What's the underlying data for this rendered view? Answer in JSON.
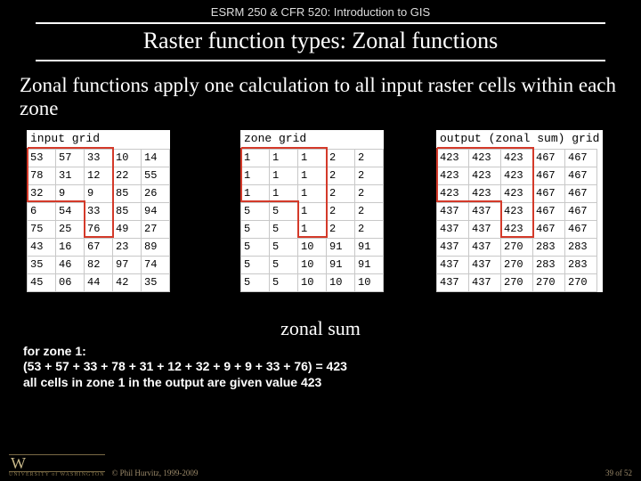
{
  "course_header": "ESRM 250 & CFR 520: Introduction to GIS",
  "slide_title": "Raster function types: Zonal functions",
  "body_text": "Zonal functions apply one calculation to all input raster cells within each zone",
  "grids": {
    "input": {
      "caption": "input grid",
      "rows": [
        [
          "53",
          "57",
          "33",
          "10",
          "14"
        ],
        [
          "78",
          "31",
          "12",
          "22",
          "55"
        ],
        [
          "32",
          "9",
          "9",
          "85",
          "26"
        ],
        [
          "6",
          "54",
          "33",
          "85",
          "94"
        ],
        [
          "75",
          "25",
          "76",
          "49",
          "27"
        ],
        [
          "43",
          "16",
          "67",
          "23",
          "89"
        ],
        [
          "35",
          "46",
          "82",
          "97",
          "74"
        ],
        [
          "45",
          "06",
          "44",
          "42",
          "35"
        ]
      ]
    },
    "zone": {
      "caption": "zone grid",
      "rows": [
        [
          "1",
          "1",
          "1",
          "2",
          "2"
        ],
        [
          "1",
          "1",
          "1",
          "2",
          "2"
        ],
        [
          "1",
          "1",
          "1",
          "2",
          "2"
        ],
        [
          "5",
          "5",
          "1",
          "2",
          "2"
        ],
        [
          "5",
          "5",
          "1",
          "2",
          "2"
        ],
        [
          "5",
          "5",
          "10",
          "91",
          "91"
        ],
        [
          "5",
          "5",
          "10",
          "91",
          "91"
        ],
        [
          "5",
          "5",
          "10",
          "10",
          "10"
        ]
      ]
    },
    "output": {
      "caption": "output (zonal sum) grid",
      "rows": [
        [
          "423",
          "423",
          "423",
          "467",
          "467"
        ],
        [
          "423",
          "423",
          "423",
          "467",
          "467"
        ],
        [
          "423",
          "423",
          "423",
          "467",
          "467"
        ],
        [
          "437",
          "437",
          "423",
          "467",
          "467"
        ],
        [
          "437",
          "437",
          "423",
          "467",
          "467"
        ],
        [
          "437",
          "437",
          "270",
          "283",
          "283"
        ],
        [
          "437",
          "437",
          "270",
          "283",
          "283"
        ],
        [
          "437",
          "437",
          "270",
          "270",
          "270"
        ]
      ]
    }
  },
  "operation_label": "zonal sum",
  "calc": {
    "line1": "for zone 1:",
    "line2": "(53 + 57 + 33 + 78 + 31 + 12 + 32 + 9 + 9 + 33 + 76) = 423",
    "line3": "all cells in zone 1 in the output are given value 423"
  },
  "footer": {
    "logo_text": "W",
    "logo_sub": "UNIVERSITY of WASHINGTON",
    "copyright": "© Phil Hurvitz, 1999-2009",
    "page": "39 of 52"
  },
  "chart_data": {
    "type": "table",
    "title": "Zonal sum raster operation",
    "tables": [
      {
        "name": "input grid",
        "rows": [
          [
            53,
            57,
            33,
            10,
            14
          ],
          [
            78,
            31,
            12,
            22,
            55
          ],
          [
            32,
            9,
            9,
            85,
            26
          ],
          [
            6,
            54,
            33,
            85,
            94
          ],
          [
            75,
            25,
            76,
            49,
            27
          ],
          [
            43,
            16,
            67,
            23,
            89
          ],
          [
            35,
            46,
            82,
            97,
            74
          ],
          [
            45,
            6,
            44,
            42,
            35
          ]
        ]
      },
      {
        "name": "zone grid",
        "rows": [
          [
            1,
            1,
            1,
            2,
            2
          ],
          [
            1,
            1,
            1,
            2,
            2
          ],
          [
            1,
            1,
            1,
            2,
            2
          ],
          [
            5,
            5,
            1,
            2,
            2
          ],
          [
            5,
            5,
            1,
            2,
            2
          ],
          [
            5,
            5,
            10,
            91,
            91
          ],
          [
            5,
            5,
            10,
            91,
            91
          ],
          [
            5,
            5,
            10,
            10,
            10
          ]
        ]
      },
      {
        "name": "output (zonal sum) grid",
        "rows": [
          [
            423,
            423,
            423,
            467,
            467
          ],
          [
            423,
            423,
            423,
            467,
            467
          ],
          [
            423,
            423,
            423,
            467,
            467
          ],
          [
            437,
            437,
            423,
            467,
            467
          ],
          [
            437,
            437,
            423,
            467,
            467
          ],
          [
            437,
            437,
            270,
            283,
            283
          ],
          [
            437,
            437,
            270,
            283,
            283
          ],
          [
            437,
            437,
            270,
            270,
            270
          ]
        ]
      }
    ],
    "zone1_sum_expression": "53+57+33+78+31+12+32+9+9+33+76=423"
  }
}
